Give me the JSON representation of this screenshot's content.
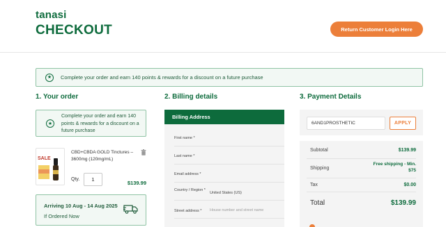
{
  "header": {
    "brand": "tanasi",
    "title": "CHECKOUT",
    "login_button": "Return Customer Login Here"
  },
  "banner": {
    "text": "Complete your order and earn 140 points & rewards for a discount on a future purchase"
  },
  "order": {
    "title": "1. Your order",
    "reward_text": "Complete your order and earn 140 points & rewards for a discount on a future purchase",
    "product": {
      "name": "CBD+CBDA GOLD Tinctures – 3600mg (120mg/mL)",
      "image_tag": "SALE",
      "qty_label": "Qty.",
      "qty": "1",
      "price": "$139.99"
    },
    "delivery": {
      "title": "Arriving 10 Aug - 14 Aug 2025",
      "subtitle": "If Ordered Now"
    }
  },
  "billing": {
    "title": "2. Billing details",
    "header": "Billing Address",
    "fields": {
      "first_name": {
        "label": "First name *"
      },
      "last_name": {
        "label": "Last name *"
      },
      "email": {
        "label": "Email address *"
      },
      "country": {
        "label": "Country / Region *",
        "value": "United States (US)"
      },
      "street": {
        "label": "Street address *",
        "placeholder": "House number and street name"
      }
    }
  },
  "payment": {
    "title": "3. Payment Details",
    "coupon_value": "6AND1PROSTHETIC",
    "apply_label": "APPLY",
    "subtotal_label": "Subtotal",
    "subtotal_value": "$139.99",
    "shipping_label": "Shipping",
    "shipping_value": "Free shipping - Min. $75",
    "tax_label": "Tax",
    "tax_value": "$0.00",
    "total_label": "Total",
    "total_value": "$139.99"
  },
  "colors": {
    "brand_green": "#0d6b3c",
    "accent_orange": "#ec7f3a",
    "panel_bg": "#f4f4f4",
    "banner_bg": "#f2f8f4"
  },
  "icons": {
    "reward": "star-badge-icon",
    "trash": "trash-icon",
    "truck": "truck-icon"
  }
}
